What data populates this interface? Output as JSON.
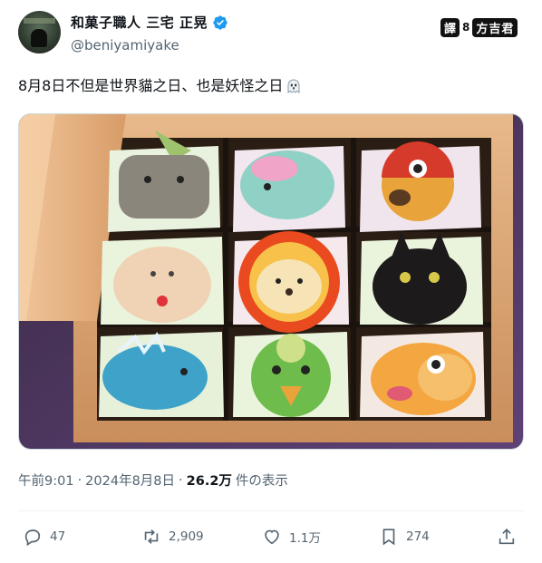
{
  "author": {
    "display_name": "和菓子職人 三宅 正晃",
    "handle": "@beniyamiyake"
  },
  "translate_badge": {
    "kanji": "譯",
    "num": "8",
    "brand": "方吉君"
  },
  "tweet": {
    "text": "8月8日不但是世界貓之日、也是妖怪之日"
  },
  "meta": {
    "time": "午前9:01",
    "sep1": "·",
    "date": "2024年8月8日",
    "sep2": "·",
    "views_count": "26.2万",
    "views_label": "件の表示"
  },
  "actions": {
    "reply_count": "47",
    "repost_count": "2,909",
    "like_count": "1.1万",
    "bookmark_count": "274"
  },
  "colors": {
    "verified": "#1d9bf0",
    "secondary_text": "#536471",
    "primary_text": "#0f1419"
  }
}
